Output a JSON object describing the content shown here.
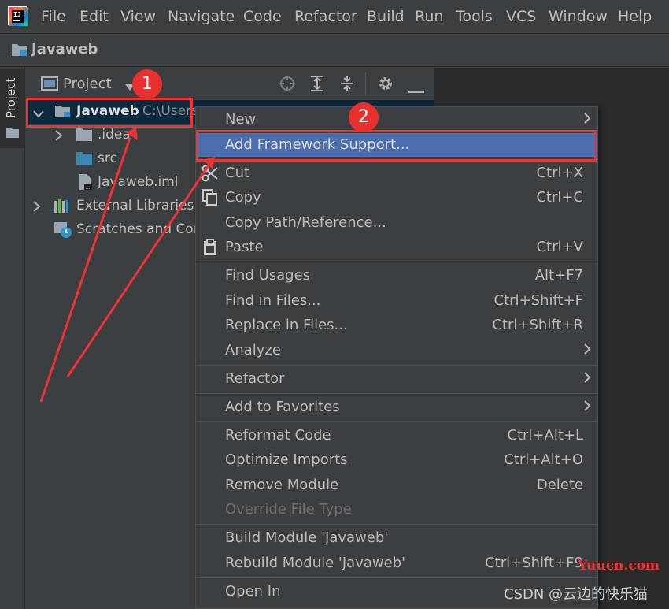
{
  "menubar": {
    "items": [
      {
        "label": "File"
      },
      {
        "label": "Edit"
      },
      {
        "label": "View"
      },
      {
        "label": "Navigate"
      },
      {
        "label": "Code"
      },
      {
        "label": "Refactor"
      },
      {
        "label": "Build"
      },
      {
        "label": "Run"
      },
      {
        "label": "Tools"
      },
      {
        "label": "VCS"
      },
      {
        "label": "Window"
      },
      {
        "label": "Help"
      }
    ],
    "logo_text": "IJ"
  },
  "breadcrumb": {
    "project": "Javaweb"
  },
  "toolstrip": {
    "tab_label": "Project"
  },
  "project_panel": {
    "title": "Project",
    "tree": [
      {
        "label": "Javaweb",
        "path": "C:\\Users"
      },
      {
        "label": ".idea"
      },
      {
        "label": "src"
      },
      {
        "label": "Javaweb.iml"
      },
      {
        "label": "External Libraries"
      },
      {
        "label": "Scratches and Con"
      }
    ]
  },
  "context_menu": {
    "items": [
      {
        "label": "New"
      },
      {
        "label": "Add Framework Support..."
      },
      {
        "label": "Cut",
        "shortcut": "Ctrl+X"
      },
      {
        "label": "Copy",
        "shortcut": "Ctrl+C"
      },
      {
        "label": "Copy Path/Reference..."
      },
      {
        "label": "Paste",
        "shortcut": "Ctrl+V"
      },
      {
        "label": "Find Usages",
        "shortcut": "Alt+F7"
      },
      {
        "label": "Find in Files...",
        "shortcut": "Ctrl+Shift+F"
      },
      {
        "label": "Replace in Files...",
        "shortcut": "Ctrl+Shift+R"
      },
      {
        "label": "Analyze"
      },
      {
        "label": "Refactor"
      },
      {
        "label": "Add to Favorites"
      },
      {
        "label": "Reformat Code",
        "shortcut": "Ctrl+Alt+L"
      },
      {
        "label": "Optimize Imports",
        "shortcut": "Ctrl+Alt+O"
      },
      {
        "label": "Remove Module",
        "shortcut": "Delete"
      },
      {
        "label": "Override File Type"
      },
      {
        "label": "Build Module 'Javaweb'"
      },
      {
        "label": "Rebuild Module 'Javaweb'",
        "shortcut": "Ctrl+Shift+F9"
      },
      {
        "label": "Open In"
      }
    ]
  },
  "annotations": {
    "badge_1": "1",
    "badge_2": "2"
  },
  "watermarks": {
    "site": "Yuucn.com",
    "credit": "CSDN @云边的快乐猫"
  },
  "colors": {
    "selection": "#4b6eaf",
    "annotation": "#ee3333",
    "panel": "#3c3f41",
    "editor": "#2b2b2b"
  }
}
